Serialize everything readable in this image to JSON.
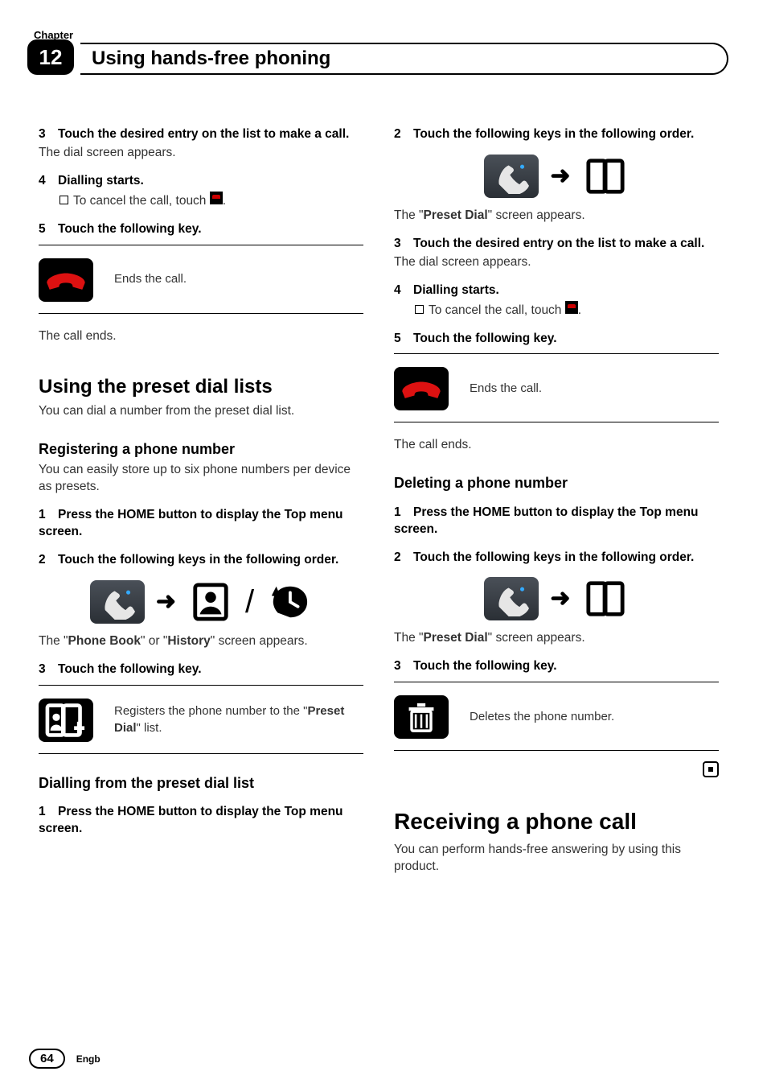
{
  "header": {
    "chapter_label": "Chapter",
    "chapter_number": "12",
    "title": "Using hands-free phoning"
  },
  "left": {
    "s3": "Touch the desired entry on the list to make a call.",
    "s3_body": "The dial screen appears.",
    "s4": "Dialling starts.",
    "s4_note_a": "To cancel the call, touch ",
    "s4_note_b": ".",
    "s5": "Touch the following key.",
    "key_end_desc": "Ends the call.",
    "call_ends": "The call ends.",
    "h2_preset": "Using the preset dial lists",
    "preset_body": "You can dial a number from the preset dial list.",
    "h3_register": "Registering a phone number",
    "register_body": "You can easily store up to six phone numbers per device as presets.",
    "r1": "Press the HOME button to display the Top menu screen.",
    "r2": "Touch the following keys in the following order.",
    "pb_hist_a": "The \"",
    "pb_bold": "Phone Book",
    "pb_hist_b": "\" or \"",
    "hist_bold": "History",
    "pb_hist_c": "\" screen appears.",
    "r3": "Touch the following key.",
    "key_reg_desc_a": "Registers the phone number to the \"",
    "key_reg_bold": "Preset Dial",
    "key_reg_desc_b": "\" list.",
    "h3_dial": "Dialling from the preset dial list",
    "d1": "Press the HOME button to display the Top menu screen."
  },
  "right": {
    "d2": "Touch the following keys in the following order.",
    "pd_a": "The \"",
    "pd_bold": "Preset Dial",
    "pd_b": "\" screen appears.",
    "d3": "Touch the desired entry on the list to make a call.",
    "d3_body": "The dial screen appears.",
    "d4": "Dialling starts.",
    "d4_note_a": "To cancel the call, touch ",
    "d4_note_b": ".",
    "d5": "Touch the following key.",
    "key_end_desc": "Ends the call.",
    "call_ends": "The call ends.",
    "h3_delete": "Deleting a phone number",
    "del1": "Press the HOME button to display the Top menu screen.",
    "del2": "Touch the following keys in the following order.",
    "del_pd_a": "The \"",
    "del_pd_bold": "Preset Dial",
    "del_pd_b": "\" screen appears.",
    "del3": "Touch the following key.",
    "key_del_desc": "Deletes the phone number.",
    "h2_receive": "Receiving a phone call",
    "receive_body": "You can perform hands-free answering by using this product."
  },
  "labels": {
    "n1": "1",
    "n2": "2",
    "n3": "3",
    "n4": "4",
    "n5": "5"
  },
  "footer": {
    "page": "64",
    "lang": "Engb"
  }
}
